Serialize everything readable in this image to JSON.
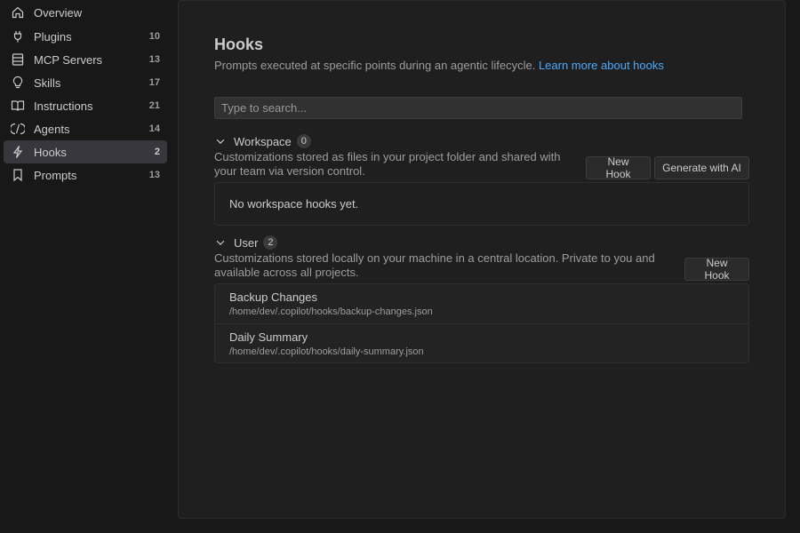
{
  "sidebar": {
    "items": [
      {
        "label": "Overview",
        "count": "",
        "icon": "home-icon"
      },
      {
        "label": "Plugins",
        "count": "10",
        "icon": "plug-icon"
      },
      {
        "label": "MCP Servers",
        "count": "13",
        "icon": "server-icon"
      },
      {
        "label": "Skills",
        "count": "17",
        "icon": "lightbulb-icon"
      },
      {
        "label": "Instructions",
        "count": "21",
        "icon": "book-icon"
      },
      {
        "label": "Agents",
        "count": "14",
        "icon": "agent-icon"
      },
      {
        "label": "Hooks",
        "count": "2",
        "icon": "lightning-icon",
        "active": true
      },
      {
        "label": "Prompts",
        "count": "13",
        "icon": "bookmark-icon"
      }
    ]
  },
  "page": {
    "title": "Hooks",
    "subtitle": "Prompts executed at specific points during an agentic lifecycle.",
    "learn_more": "Learn more about hooks"
  },
  "search": {
    "placeholder": "Type to search...",
    "value": ""
  },
  "workspace": {
    "title": "Workspace",
    "count": "0",
    "description": "Customizations stored as files in your project folder and shared with your team via version control.",
    "new_hook_label": "New Hook",
    "generate_label": "Generate with AI",
    "empty_text": "No workspace hooks yet."
  },
  "user": {
    "title": "User",
    "count": "2",
    "description": "Customizations stored locally on your machine in a central location. Private to you and available across all projects.",
    "new_hook_label": "New Hook",
    "hooks": [
      {
        "name": "Backup Changes",
        "path": "/home/dev/.copilot/hooks/backup-changes.json"
      },
      {
        "name": "Daily Summary",
        "path": "/home/dev/.copilot/hooks/daily-summary.json"
      }
    ]
  },
  "colors": {
    "background": "#181818",
    "panel": "#1f1f1f",
    "active_item": "#37373d",
    "link": "#4daafc"
  }
}
